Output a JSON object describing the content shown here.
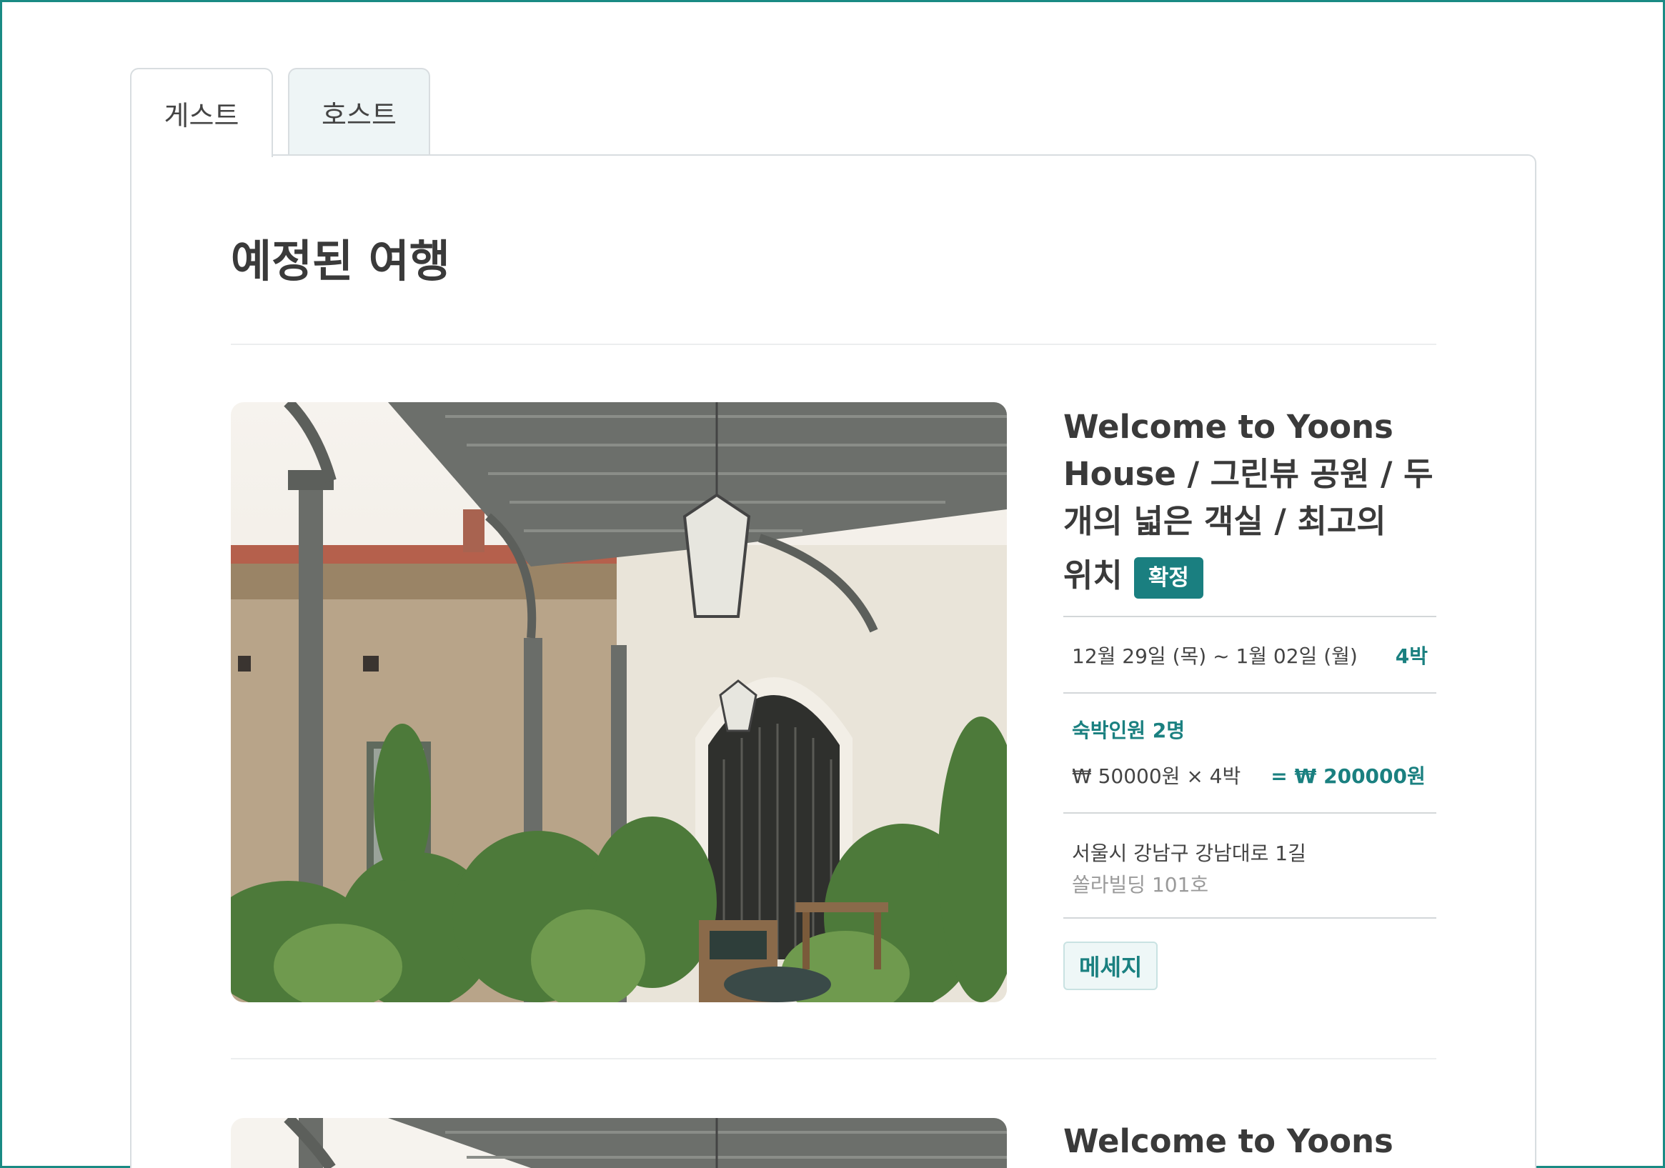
{
  "tabs": [
    {
      "label": "게스트"
    },
    {
      "label": "호스트"
    }
  ],
  "page": {
    "title": "예정된 여행"
  },
  "trips": [
    {
      "name": "Welcome to Yoons House / 그린뷰 공원 / 두 개의 넓은 객실 / 최고의 위치",
      "name_lines": [
        "Welcome to Yoons",
        "House / 그린뷰 공원 / 두",
        "개의 넓은 객실 / 최고의",
        "위치"
      ],
      "status": "확정",
      "dates": "12월 29일 (목) ~ 1월 02일 (월)",
      "nights": "4박",
      "guests": "숙박인원 2명",
      "unit_price": "₩ 50000원 × 4박",
      "total": "= ₩ 200000원",
      "address": "서울시 강남구 강남대로 1길",
      "address_detail": "쏠라빌딩 101호",
      "message_label": "메세지"
    },
    {
      "name_first_line": "Welcome to Yoons"
    }
  ],
  "colors": {
    "accent": "#1a7f80",
    "frame": "#1a8a84",
    "tab_inactive_bg": "#eef5f6"
  },
  "image_subject": "covered terrace with plants and lantern"
}
